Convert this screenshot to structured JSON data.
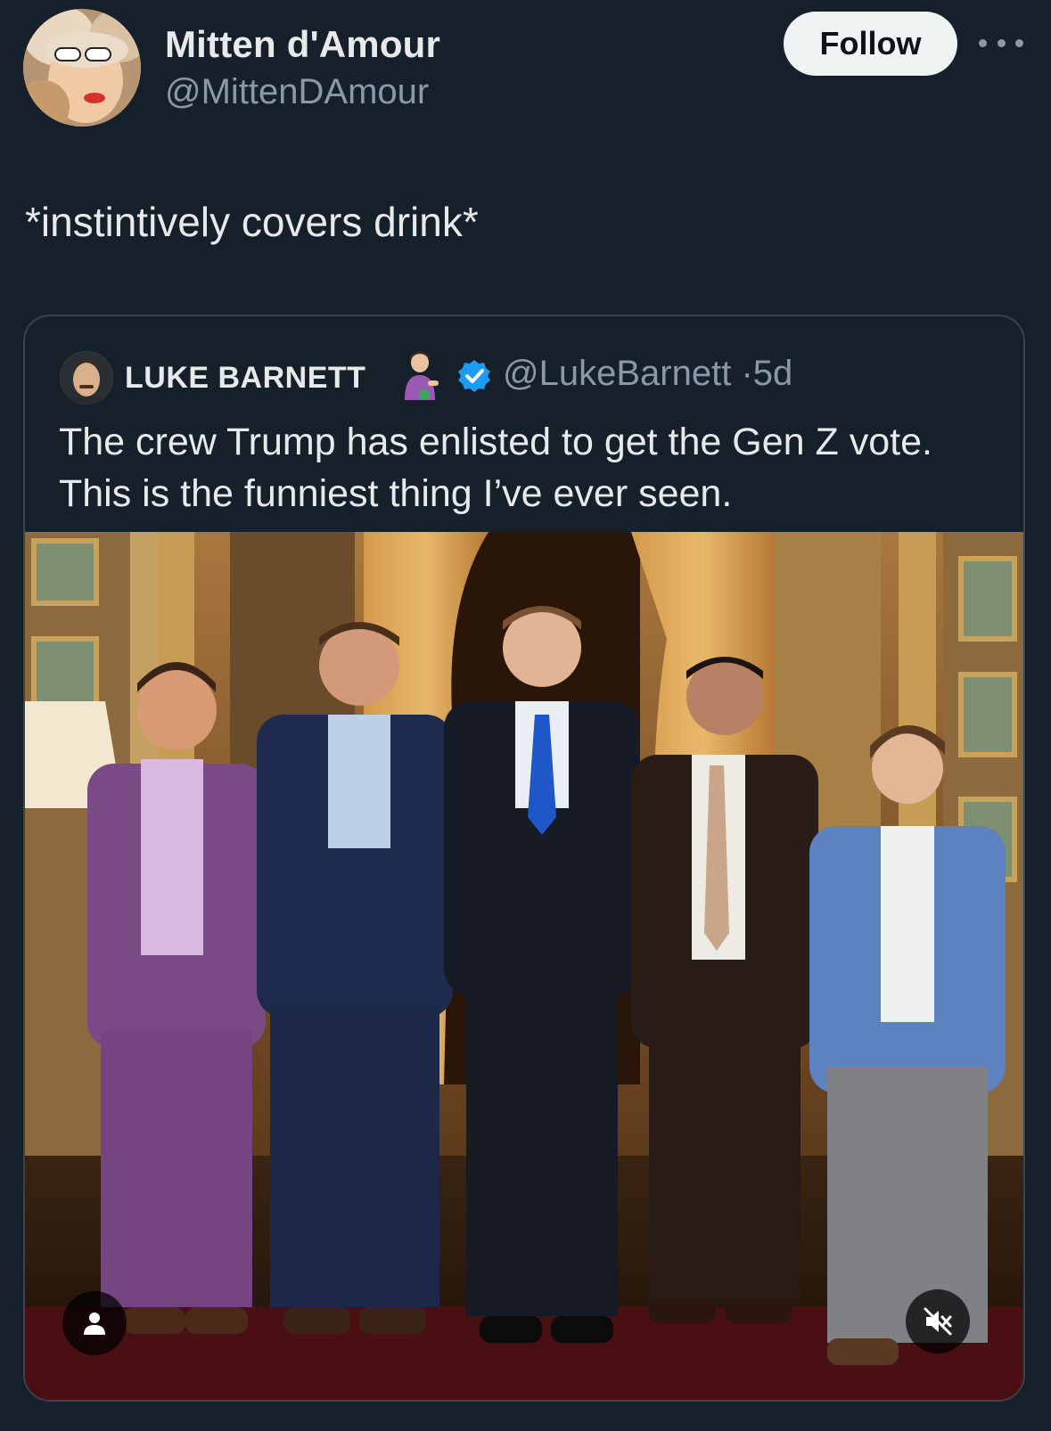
{
  "tweet": {
    "author": {
      "display_name": "Mitten d'Amour",
      "handle": "@MittenDAmour",
      "avatar_icon": "profile-photo"
    },
    "follow_label": "Follow",
    "more_icon": "more-horizontal-icon",
    "text": "*instintively covers drink*"
  },
  "quoted_tweet": {
    "author": {
      "display_name": "LUKE BARNETT",
      "handle": "@LukeBarnett",
      "emoji_icon": "person-tipping-hand-emoji",
      "verified_icon": "verified-badge-icon",
      "verified_color": "#1d9bf0"
    },
    "time_sep": "·",
    "time": "5d",
    "text_lines": [
      "The crew Trump has enlisted to get the Gen Z vote.",
      "This is the funniest thing I’ve ever seen."
    ],
    "media": {
      "type": "photo",
      "people_count": 5,
      "tag_icon": "person-icon",
      "mute_icon": "muted-speaker-icon"
    }
  },
  "colors": {
    "background": "#15202b",
    "text_primary": "#e7e9ea",
    "text_secondary": "#8b98a5",
    "follow_bg": "#eff3f4",
    "border": "#38444d"
  }
}
